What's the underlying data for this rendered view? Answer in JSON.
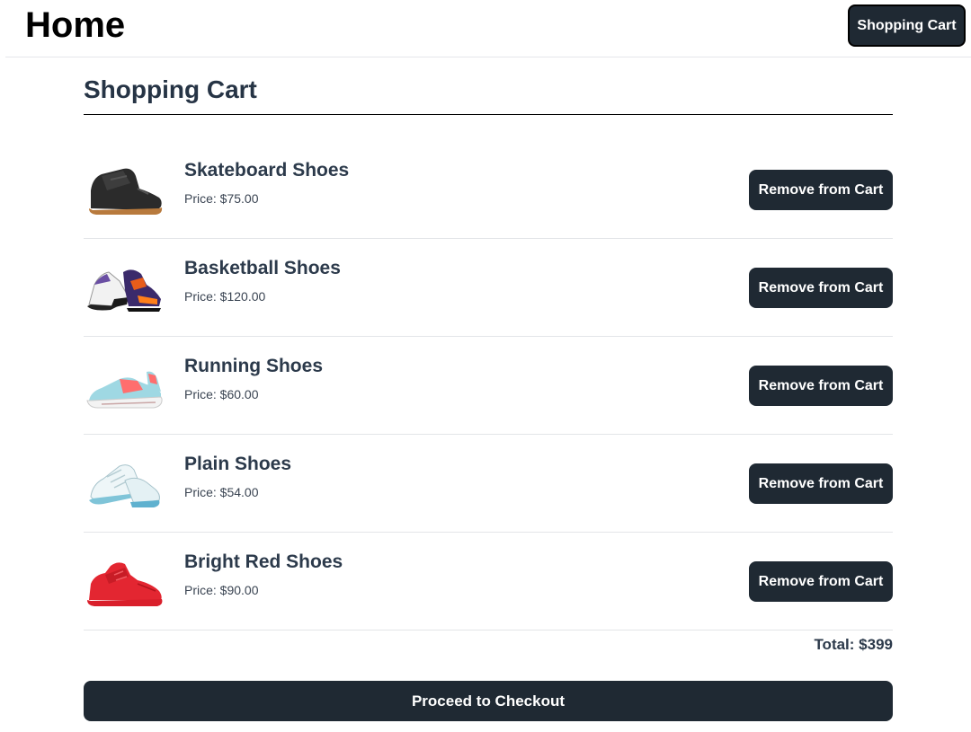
{
  "header": {
    "title": "Home",
    "cart_button_label": "Shopping Cart"
  },
  "cart": {
    "heading": "Shopping Cart",
    "items": [
      {
        "name": "Skateboard Shoes",
        "price": "Price: $75.00",
        "remove_label": "Remove from Cart",
        "image": "skateboard-shoe"
      },
      {
        "name": "Basketball Shoes",
        "price": "Price: $120.00",
        "remove_label": "Remove from Cart",
        "image": "basketball-shoe"
      },
      {
        "name": "Running Shoes",
        "price": "Price: $60.00",
        "remove_label": "Remove from Cart",
        "image": "running-shoe"
      },
      {
        "name": "Plain Shoes",
        "price": "Price: $54.00",
        "remove_label": "Remove from Cart",
        "image": "plain-shoe"
      },
      {
        "name": "Bright Red Shoes",
        "price": "Price: $90.00",
        "remove_label": "Remove from Cart",
        "image": "red-shoe"
      }
    ],
    "total": "Total: $399",
    "checkout_label": "Proceed to Checkout"
  },
  "colors": {
    "button_bg": "#1f2933",
    "heading_text": "#263445"
  }
}
